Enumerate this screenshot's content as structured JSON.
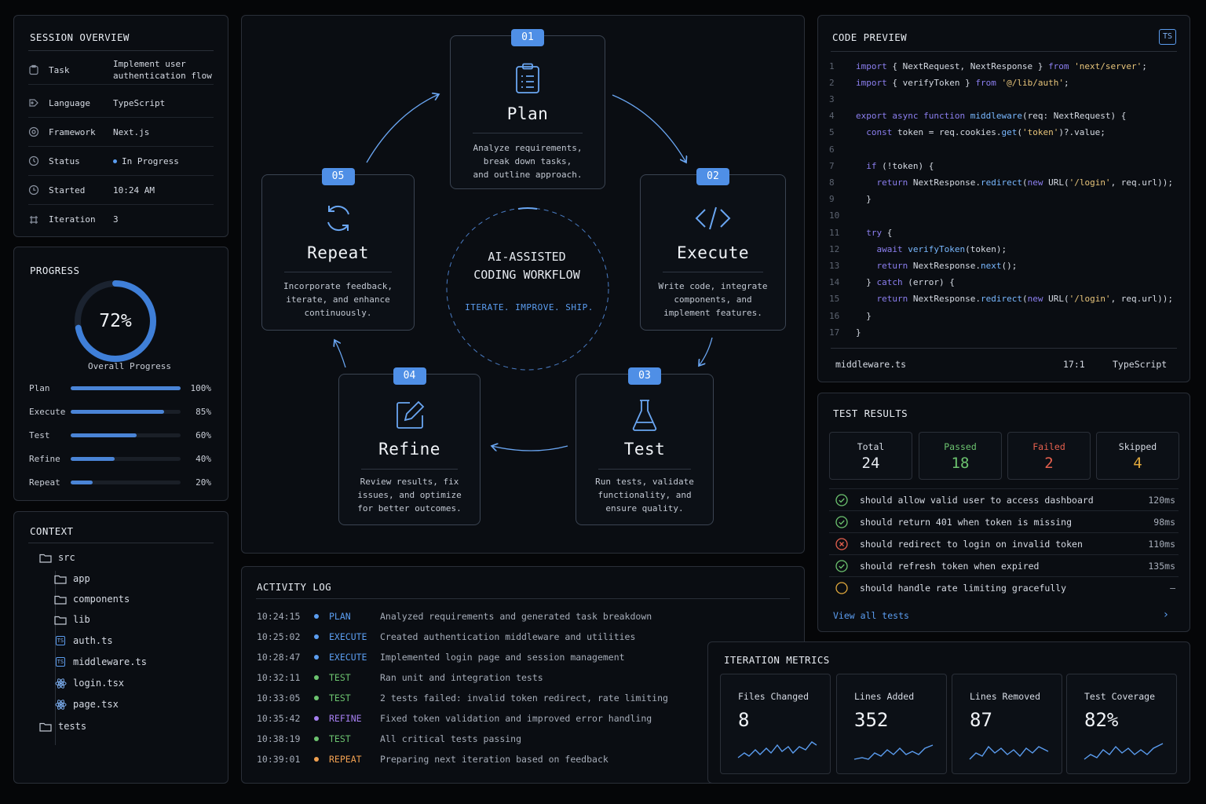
{
  "session": {
    "title": "SESSION OVERVIEW",
    "rows": [
      {
        "label": "Task",
        "value": "Implement user authentication flow",
        "icon": "clipboard-icon"
      },
      {
        "label": "Language",
        "value": "TypeScript",
        "icon": "tag-icon"
      },
      {
        "label": "Framework",
        "value": "Next.js",
        "icon": "globe-icon"
      },
      {
        "label": "Status",
        "value": "In Progress",
        "icon": "status-icon"
      },
      {
        "label": "Started",
        "value": "10:24 AM",
        "icon": "clock-icon"
      },
      {
        "label": "Iteration",
        "value": "3",
        "icon": "iteration-icon"
      }
    ]
  },
  "progress": {
    "title": "PROGRESS",
    "overall": "72%",
    "overall_fraction": 0.72,
    "overall_label": "Overall Progress",
    "items": [
      {
        "label": "Plan",
        "value": "100%",
        "fraction": 1.0
      },
      {
        "label": "Execute",
        "value": "85%",
        "fraction": 0.85
      },
      {
        "label": "Test",
        "value": "60%",
        "fraction": 0.6
      },
      {
        "label": "Refine",
        "value": "40%",
        "fraction": 0.4
      },
      {
        "label": "Repeat",
        "value": "20%",
        "fraction": 0.2
      }
    ]
  },
  "context": {
    "title": "CONTEXT",
    "tree": [
      {
        "name": "src",
        "type": "folder"
      },
      {
        "name": "app",
        "type": "folder"
      },
      {
        "name": "components",
        "type": "folder"
      },
      {
        "name": "lib",
        "type": "folder"
      },
      {
        "name": "auth.ts",
        "type": "ts"
      },
      {
        "name": "middleware.ts",
        "type": "ts"
      },
      {
        "name": "login.tsx",
        "type": "react"
      },
      {
        "name": "page.tsx",
        "type": "react"
      },
      {
        "name": "tests",
        "type": "folder"
      }
    ],
    "ts_badge": "TS"
  },
  "workflow": {
    "center_title_1": "AI-ASSISTED",
    "center_title_2": "CODING WORKFLOW",
    "center_subtitle": "ITERATE. IMPROVE. SHIP.",
    "nodes": [
      {
        "num": "01",
        "title": "Plan",
        "desc1": "Analyze requirements,",
        "desc2": "break down tasks,",
        "desc3": "and outline approach.",
        "icon": "clipboard-list-icon"
      },
      {
        "num": "02",
        "title": "Execute",
        "desc1": "Write code, integrate",
        "desc2": "components, and",
        "desc3": "implement features.",
        "icon": "code-icon"
      },
      {
        "num": "03",
        "title": "Test",
        "desc1": "Run tests, validate",
        "desc2": "functionality, and",
        "desc3": "ensure quality.",
        "icon": "flask-icon"
      },
      {
        "num": "04",
        "title": "Refine",
        "desc1": "Review results, fix",
        "desc2": "issues, and optimize",
        "desc3": "for better outcomes.",
        "icon": "edit-icon"
      },
      {
        "num": "05",
        "title": "Repeat",
        "desc1": "Incorporate feedback,",
        "desc2": "iterate, and enhance",
        "desc3": "continuously.",
        "icon": "refresh-icon"
      }
    ]
  },
  "activity": {
    "title": "ACTIVITY LOG",
    "rows": [
      {
        "time": "10:24:15",
        "phase": "PLAN",
        "msg": "Analyzed requirements and generated task breakdown",
        "color": "#5b9df0"
      },
      {
        "time": "10:25:02",
        "phase": "EXECUTE",
        "msg": "Created authentication middleware and utilities",
        "color": "#5b9df0"
      },
      {
        "time": "10:28:47",
        "phase": "EXECUTE",
        "msg": "Implemented login page and session management",
        "color": "#5b9df0"
      },
      {
        "time": "10:32:11",
        "phase": "TEST",
        "msg": "Ran unit and integration tests",
        "color": "#6cc36f"
      },
      {
        "time": "10:33:05",
        "phase": "TEST",
        "msg": "2 tests failed: invalid token redirect, rate limiting",
        "color": "#6cc36f"
      },
      {
        "time": "10:35:42",
        "phase": "REFINE",
        "msg": "Fixed token validation and improved error handling",
        "color": "#a57ff0"
      },
      {
        "time": "10:38:19",
        "phase": "TEST",
        "msg": "All critical tests passing",
        "color": "#6cc36f"
      },
      {
        "time": "10:39:01",
        "phase": "REPEAT",
        "msg": "Preparing next iteration based on feedback",
        "color": "#f0a050"
      }
    ]
  },
  "code": {
    "title": "CODE PREVIEW",
    "badge": "TS",
    "lines": [
      "import { NextRequest, NextResponse } from 'next/server';",
      "import { verifyToken } from '@/lib/auth';",
      "",
      "export async function middleware(req: NextRequest) {",
      "  const token = req.cookies.get('token')?.value;",
      "",
      "  if (!token) {",
      "    return NextResponse.redirect(new URL('/login', req.url));",
      "  }",
      "",
      "  try {",
      "    await verifyToken(token);",
      "    return NextResponse.next();",
      "  } catch (error) {",
      "    return NextResponse.redirect(new URL('/login', req.url));",
      "  }",
      "}"
    ],
    "file": "middleware.ts",
    "position": "17:1",
    "language": "TypeScript"
  },
  "tests": {
    "title": "TEST RESULTS",
    "stats": [
      {
        "label": "Total",
        "value": "24",
        "color": "#e8ecf2",
        "labelColor": "#d6dbe4"
      },
      {
        "label": "Passed",
        "value": "18",
        "color": "#6cc36f",
        "labelColor": "#6cc36f"
      },
      {
        "label": "Failed",
        "value": "2",
        "color": "#e5604e",
        "labelColor": "#e5604e"
      },
      {
        "label": "Skipped",
        "value": "4",
        "color": "#e0a83c",
        "labelColor": "#d6dbe4"
      }
    ],
    "rows": [
      {
        "name": "should allow valid user to access dashboard",
        "duration": "120ms",
        "status": "passed"
      },
      {
        "name": "should return 401 when token is missing",
        "duration": "98ms",
        "status": "passed"
      },
      {
        "name": "should redirect to login on invalid token",
        "duration": "110ms",
        "status": "failed"
      },
      {
        "name": "should refresh token when expired",
        "duration": "135ms",
        "status": "passed"
      },
      {
        "name": "should handle rate limiting gracefully",
        "duration": "—",
        "status": "skipped"
      }
    ],
    "view_all": "View all tests"
  },
  "metrics": {
    "title": "ITERATION METRICS",
    "cards": [
      {
        "label": "Files Changed",
        "value": "8"
      },
      {
        "label": "Lines Added",
        "value": "352"
      },
      {
        "label": "Lines Removed",
        "value": "87"
      },
      {
        "label": "Test Coverage",
        "value": "82%"
      }
    ]
  }
}
